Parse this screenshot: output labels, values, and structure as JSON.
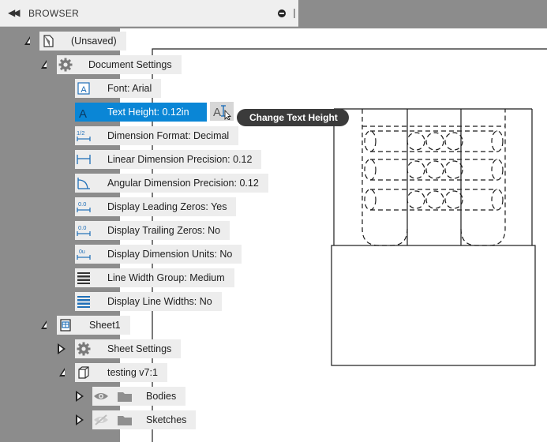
{
  "browser": {
    "title": "BROWSER",
    "collapse_icon": "double-chevron-left-icon",
    "pin_icon": "pin-icon"
  },
  "tree": {
    "root": {
      "label": "(Unsaved)",
      "icon": "document-icon"
    },
    "document_settings": {
      "label": "Document Settings",
      "icon": "gear-icon",
      "items": [
        {
          "label": "Font: Arial",
          "icon": "font-icon"
        },
        {
          "label": "Text Height: 0.12in",
          "icon": "text-height-icon",
          "selected": true
        },
        {
          "label": "Dimension Format: Decimal",
          "icon": "dimension-format-icon"
        },
        {
          "label": "Linear Dimension Precision: 0.12",
          "icon": "linear-dimension-icon"
        },
        {
          "label": "Angular Dimension Precision: 0.12",
          "icon": "angular-dimension-icon"
        },
        {
          "label": "Display Leading Zeros: Yes",
          "icon": "leading-zeros-icon"
        },
        {
          "label": "Display Trailing Zeros: No",
          "icon": "trailing-zeros-icon"
        },
        {
          "label": "Display Dimension Units: No",
          "icon": "dimension-units-icon"
        },
        {
          "label": "Line Width Group: Medium",
          "icon": "line-width-group-icon"
        },
        {
          "label": "Display Line Widths: No",
          "icon": "line-widths-icon"
        }
      ]
    },
    "sheet1": {
      "label": "Sheet1",
      "icon": "sheet-icon"
    },
    "sheet_settings": {
      "label": "Sheet Settings",
      "icon": "gear-icon"
    },
    "component": {
      "label": "testing v7:1",
      "icon": "component-icon"
    },
    "bodies": {
      "label": "Bodies",
      "icon": "folder-icon",
      "visibility_icon": "eye-icon"
    },
    "sketches": {
      "label": "Sketches",
      "icon": "folder-icon",
      "visibility_icon": "eye-hidden-icon"
    }
  },
  "tooltip": {
    "text": "Change Text Height"
  },
  "edit_button": {
    "icon": "edit-text-height-icon"
  },
  "colors": {
    "selection": "#0a86d6",
    "panel_bg": "#8c8c8c",
    "row_bg": "#ededed",
    "tooltip_bg": "#3b3b3b",
    "sheet_bg": "#ffffff"
  }
}
